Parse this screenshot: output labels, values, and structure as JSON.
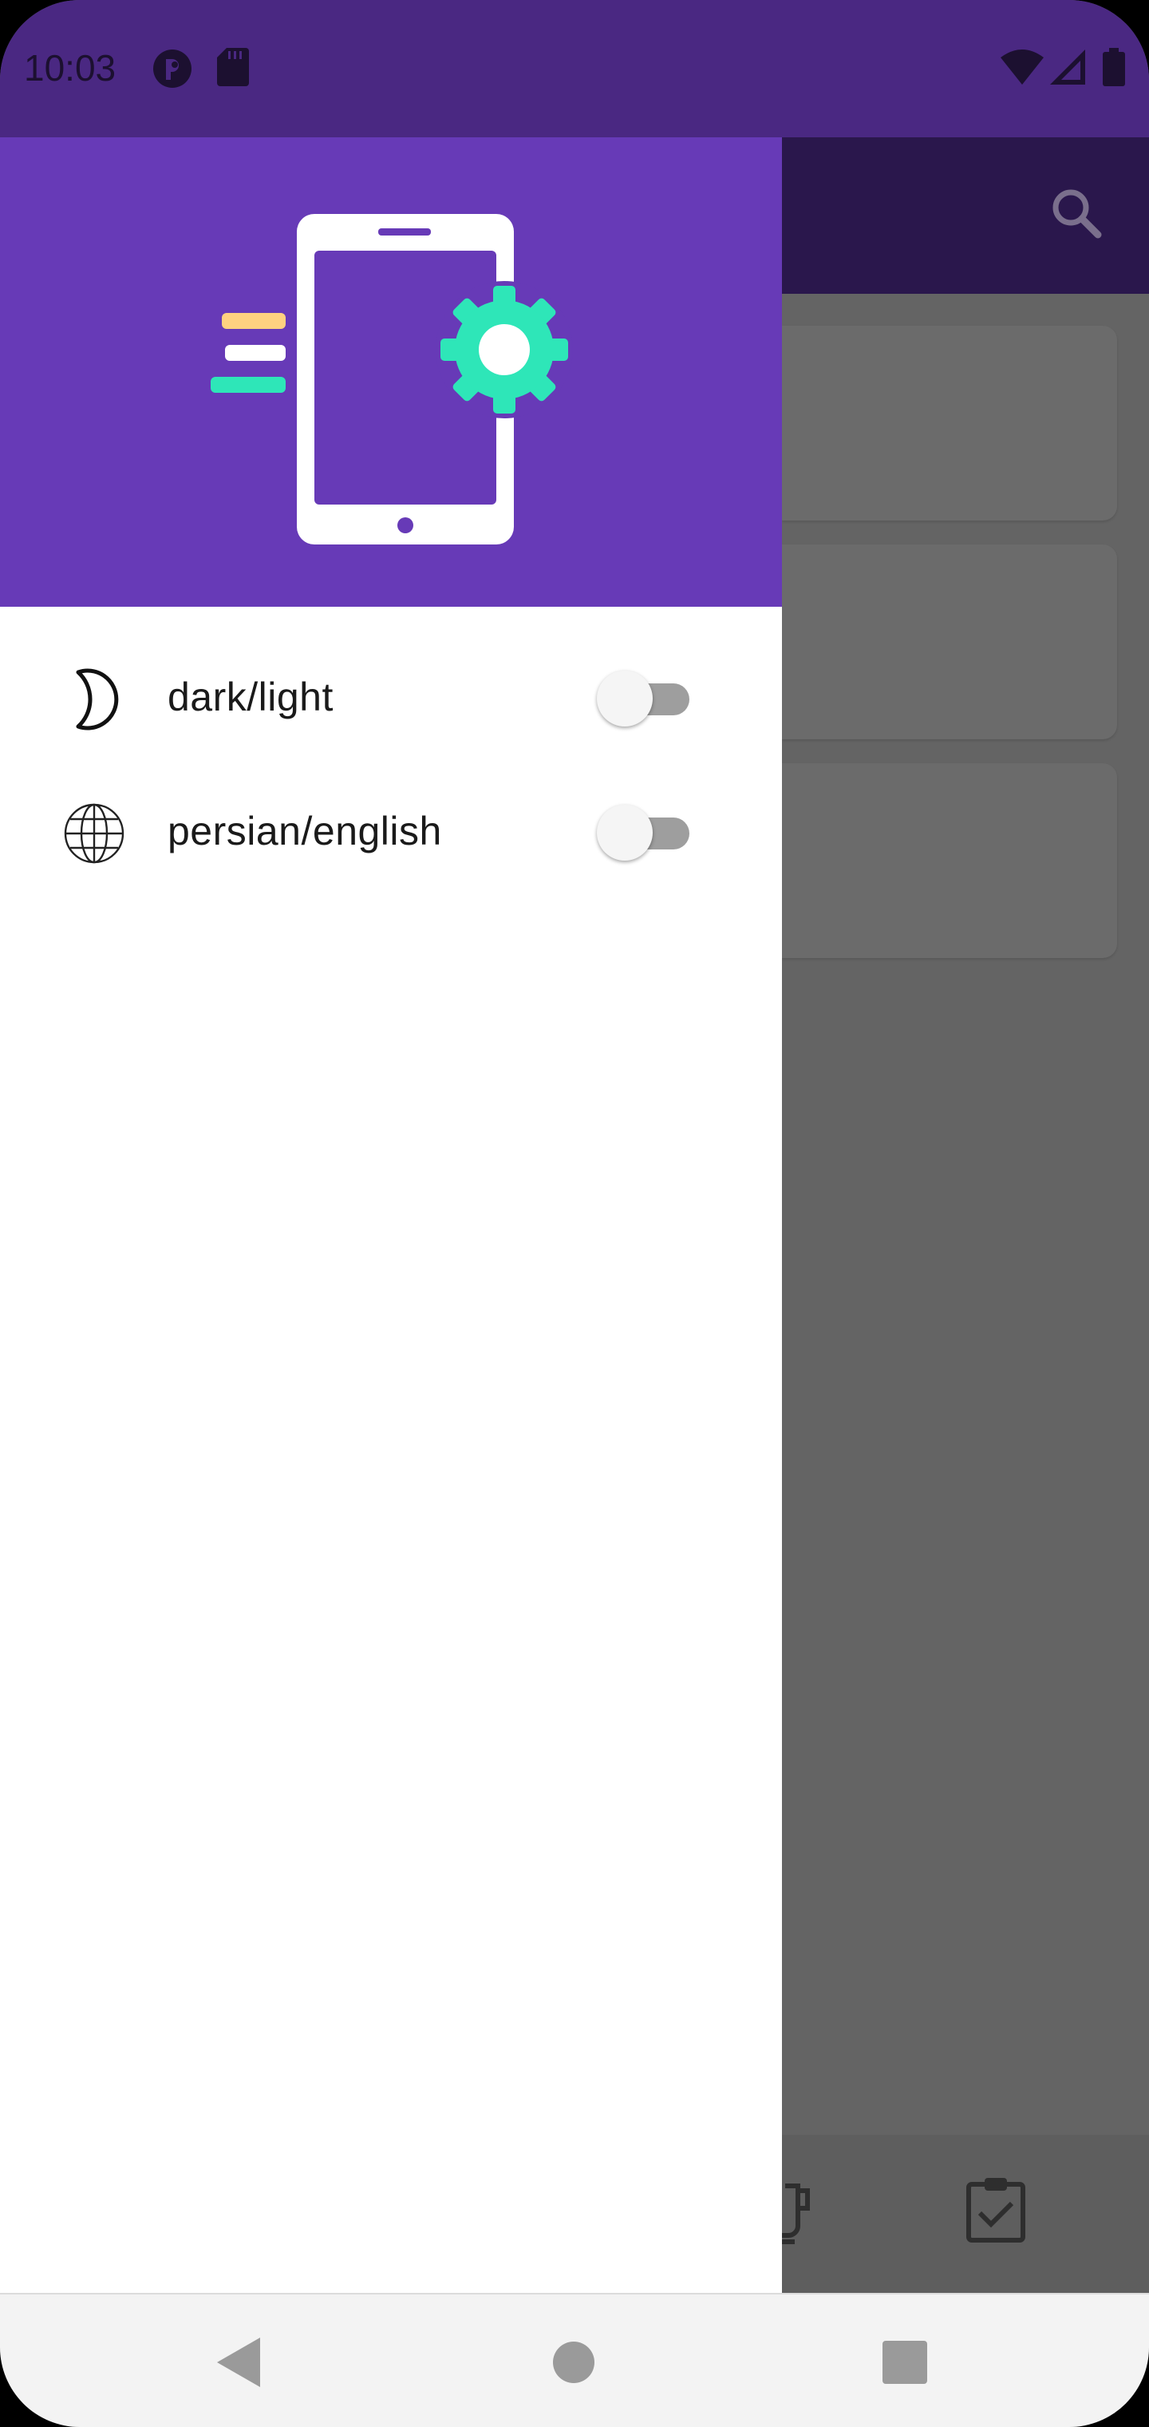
{
  "status_bar": {
    "time": "10:03",
    "icons_left": [
      "app-notification-icon",
      "sd-card-icon"
    ],
    "icons_right": [
      "wifi-icon",
      "cell-signal-icon",
      "battery-icon"
    ]
  },
  "app_bar": {
    "actions": [
      "search-icon"
    ]
  },
  "drawer": {
    "header": {
      "illustration": "phone-settings-illustration"
    },
    "settings": [
      {
        "icon": "moon-icon",
        "label": "dark/light",
        "enabled": false
      },
      {
        "icon": "globe-icon",
        "label": "persian/english",
        "enabled": false
      }
    ]
  },
  "background_content": {
    "cards": 3,
    "bottom_nav_icons": [
      "cup-icon",
      "clipboard-check-icon"
    ]
  },
  "system_nav": [
    "back-icon",
    "home-icon",
    "recents-icon"
  ],
  "colors": {
    "status_bar": "#4a2882",
    "drawer_header": "#673ab7",
    "accent_green": "#2ee6b8",
    "accent_yellow": "#ffd180",
    "scrim": "#646464"
  }
}
